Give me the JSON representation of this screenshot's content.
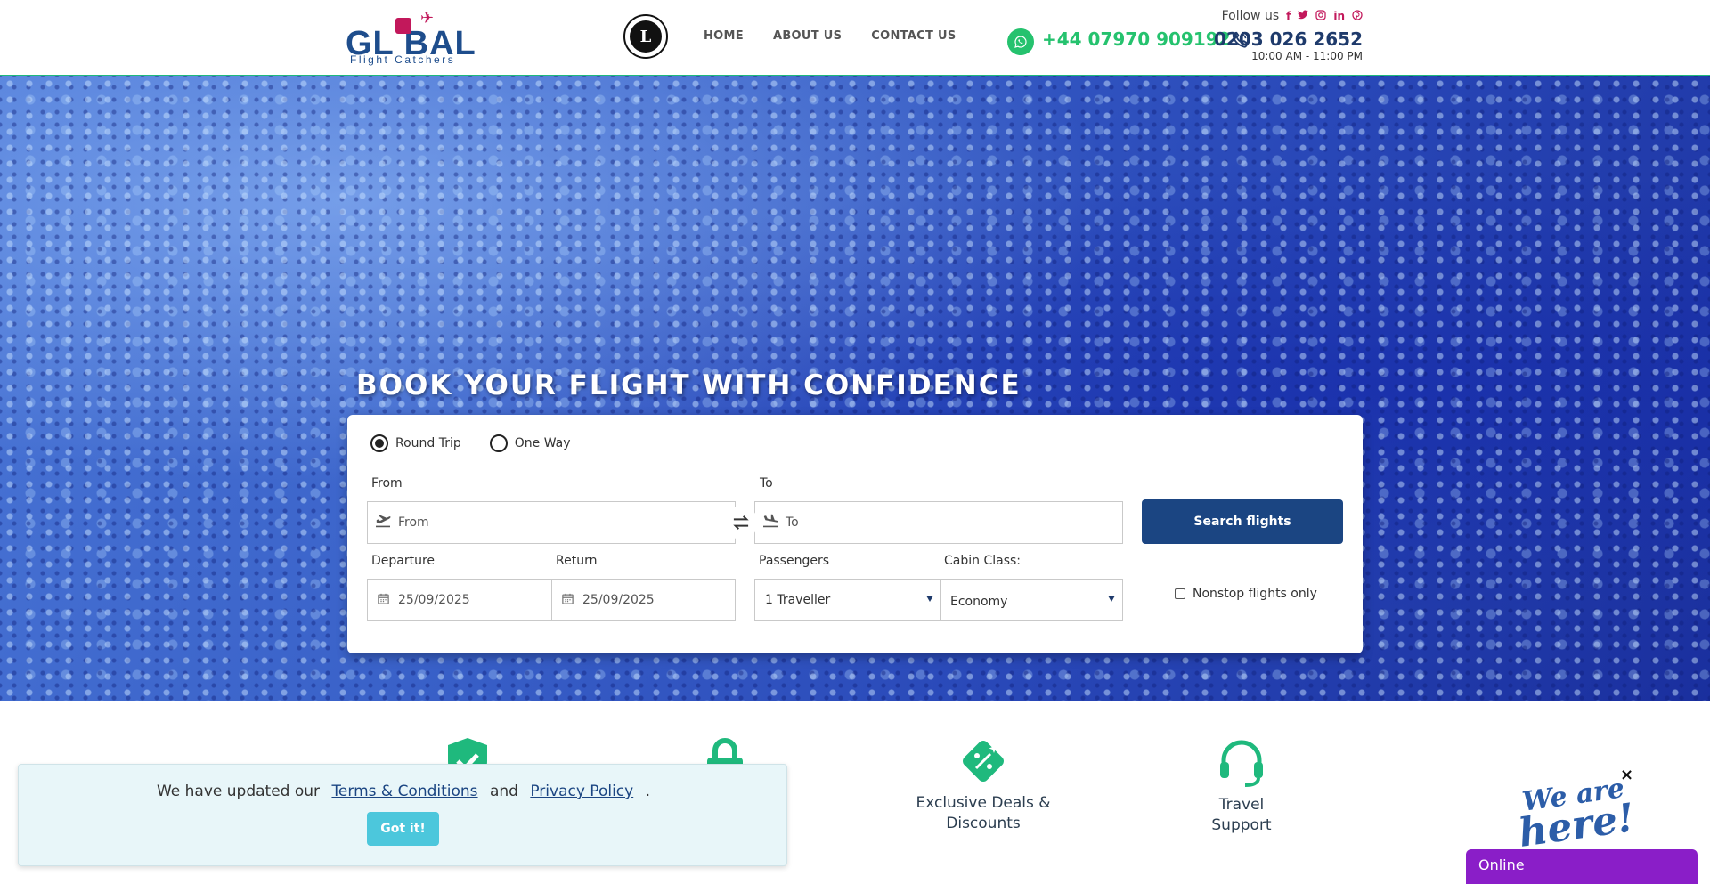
{
  "header": {
    "logo_main": "GL  BAL",
    "logo_sub": "Flight Catchers",
    "atol_mark": "L",
    "nav": [
      "HOME",
      "ABOUT US",
      "CONTACT US"
    ],
    "follow_label": "Follow us",
    "social_icons": [
      "facebook-icon",
      "twitter-icon",
      "instagram-icon",
      "linkedin-icon",
      "pinterest-icon"
    ],
    "whatsapp_number": "+44 07970 909192",
    "phone_number": "0203 026 2652",
    "hours": "10:00 AM - 11:00 PM",
    "colors": {
      "brand": "#1e4d8c",
      "accent": "#c2185b",
      "whatsapp": "#25c26e"
    }
  },
  "hero": {
    "title": "BOOK YOUR FLIGHT WITH CONFIDENCE"
  },
  "search": {
    "trip_types": [
      "Round Trip",
      "One Way"
    ],
    "selected_trip": "Round Trip",
    "from_label": "From",
    "from_placeholder": "From",
    "to_label": "To",
    "to_placeholder": "To",
    "departure_label": "Departure",
    "departure_value": "25/09/2025",
    "return_label": "Return",
    "return_value": "25/09/2025",
    "passengers_label": "Passengers",
    "passengers_value": "1 Traveller",
    "cabin_label": "Cabin Class:",
    "cabin_value": "Economy",
    "search_button": "Search flights",
    "nonstop_label": "Nonstop flights only",
    "button_color": "#1b4582"
  },
  "features": [
    {
      "icon": "shield-check-icon",
      "label": ""
    },
    {
      "icon": "lock-icon",
      "label": ""
    },
    {
      "icon": "discount-tag-icon",
      "label_line1": "Exclusive Deals &",
      "label_line2": "Discounts"
    },
    {
      "icon": "headset-icon",
      "label_line1": "Travel",
      "label_line2": "Support"
    }
  ],
  "cookie": {
    "text_before": "We have updated our",
    "terms_link": "Terms & Conditions",
    "and": "and",
    "privacy_link": "Privacy Policy",
    "period": ".",
    "button": "Got it!"
  },
  "chat": {
    "close": "×",
    "badge_line1": "We are",
    "badge_line2": "here!",
    "status": "Online",
    "color": "#8a1ec8"
  }
}
